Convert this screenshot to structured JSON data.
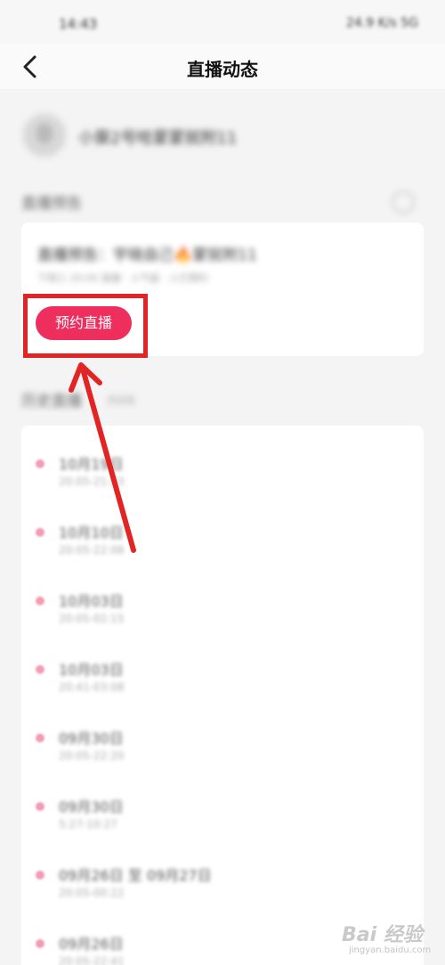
{
  "status_bar": {
    "time": "14:43",
    "indicators": "24.9 K/s 5G"
  },
  "nav": {
    "title": "直播动态",
    "back_icon": "chevron-left-icon"
  },
  "profile": {
    "name": "小葵2号哈蒙蒙就附11"
  },
  "preview": {
    "section_title": "直播预告",
    "text": "直播预告：宇晓自己🔥蒙就附11",
    "meta": "下周三 20:00 直播 · 人气值 · 人已预约",
    "book_button": "预约直播"
  },
  "history": {
    "section_title": "历史直播",
    "count": "共8场",
    "items": [
      {
        "date": "10月19日",
        "time": "20:05-21:43"
      },
      {
        "date": "10月10日",
        "time": "20:05-22:08"
      },
      {
        "date": "10月03日",
        "time": "20:05-02:15"
      },
      {
        "date": "10月03日",
        "time": "20:41-03:08"
      },
      {
        "date": "09月30日",
        "time": "20:05-22:20"
      },
      {
        "date": "09月30日",
        "time": "5:27-10:27"
      },
      {
        "date": "09月26日 至 09月27日",
        "time": "20:05-00:22"
      },
      {
        "date": "09月26日",
        "time": "20:05-22:41"
      }
    ]
  },
  "watermark": {
    "logo": "Bai 经验",
    "url": "jingyan.baidu.com"
  },
  "colors": {
    "accent": "#ee2f5d",
    "highlight": "#e22424"
  }
}
